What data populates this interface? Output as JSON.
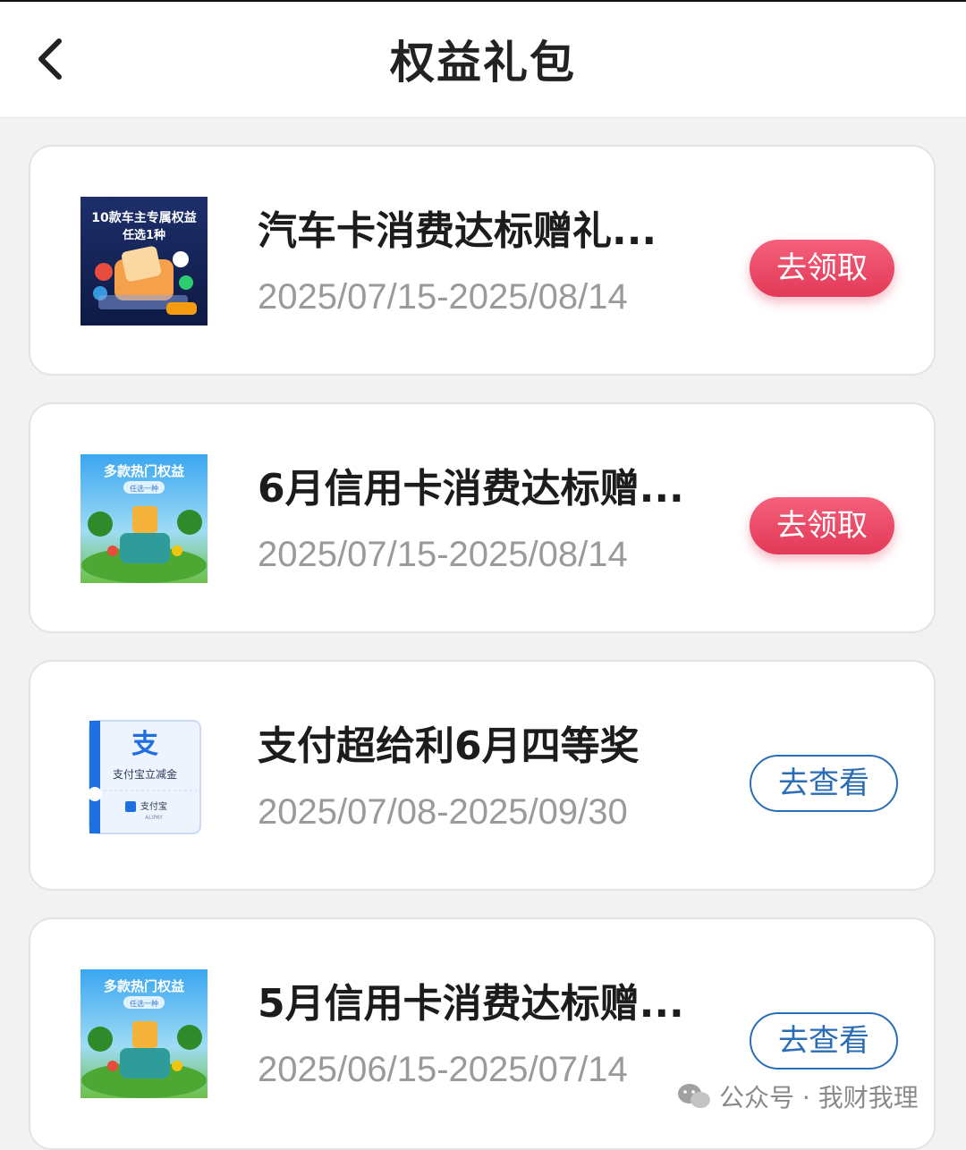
{
  "header": {
    "title": "权益礼包",
    "back_icon": "chevron-left-icon"
  },
  "items": [
    {
      "title": "汽车卡消费达标赠礼...",
      "date_range": "2025/07/15-2025/08/14",
      "button_label": "去领取",
      "button_style": "claim",
      "thumb_text_line1": "10款车主专属权益",
      "thumb_text_line2": "任选1种"
    },
    {
      "title": "6月信用卡消费达标赠...",
      "date_range": "2025/07/15-2025/08/14",
      "button_label": "去领取",
      "button_style": "claim",
      "thumb_text_line1": "多款热门权益",
      "thumb_text_line2": "任选一种"
    },
    {
      "title": "支付超给利6月四等奖",
      "date_range": "2025/07/08-2025/09/30",
      "button_label": "去查看",
      "button_style": "view",
      "thumb_text_line1": "支付宝立减金",
      "thumb_text_line2": "支付宝",
      "thumb_text_line3": "ALIPAY"
    },
    {
      "title": "5月信用卡消费达标赠...",
      "date_range": "2025/06/15-2025/07/14",
      "button_label": "去查看",
      "button_style": "view",
      "thumb_text_line1": "多款热门权益",
      "thumb_text_line2": "任选一种"
    }
  ],
  "watermark": {
    "text": "公众号 · 我财我理",
    "icon": "wechat-icon"
  },
  "colors": {
    "claim_button": "#e23a58",
    "view_button": "#2a6db5",
    "date_text": "#9a9a9a",
    "background": "#f2f2f2"
  }
}
